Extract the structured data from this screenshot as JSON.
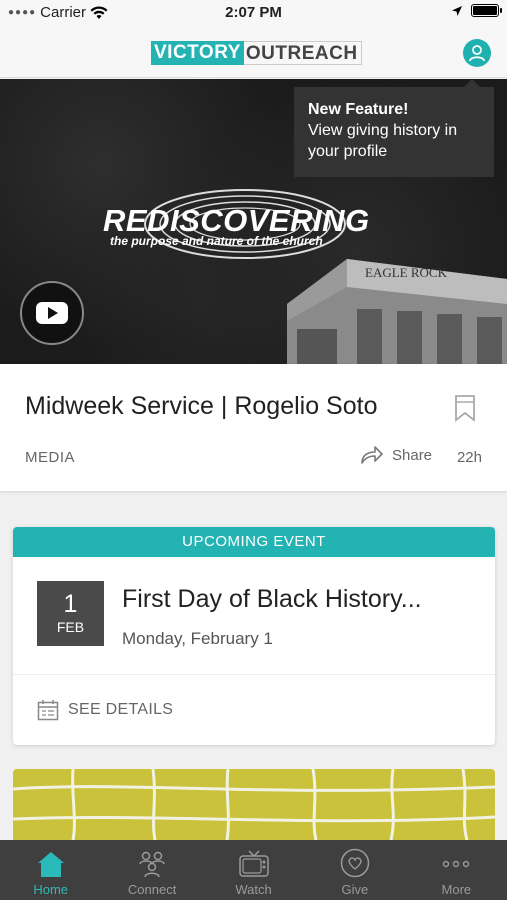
{
  "status": {
    "carrier": "Carrier",
    "time": "2:07 PM"
  },
  "header": {
    "logo_part1": "VICTORY",
    "logo_part2": "OUTREACH"
  },
  "tooltip": {
    "title": "New Feature!",
    "body": "View giving history in your profile"
  },
  "hero": {
    "title": "REDISCOVERING",
    "subtitle": "the purpose and nature of the church",
    "building_sign": "EAGLE ROCK"
  },
  "media": {
    "title": "Midweek Service | Rogelio Soto",
    "tag": "MEDIA",
    "share_label": "Share",
    "time_ago": "22h"
  },
  "event": {
    "header": "UPCOMING EVENT",
    "day": "1",
    "month": "FEB",
    "title": "First Day of Black History...",
    "date": "Monday, February 1",
    "details_label": "SEE DETAILS"
  },
  "tabs": [
    {
      "label": "Home",
      "icon": "home-icon",
      "active": true
    },
    {
      "label": "Connect",
      "icon": "connect-icon",
      "active": false
    },
    {
      "label": "Watch",
      "icon": "tv-icon",
      "active": false
    },
    {
      "label": "Give",
      "icon": "heart-icon",
      "active": false
    },
    {
      "label": "More",
      "icon": "more-icon",
      "active": false
    }
  ],
  "colors": {
    "accent": "#23b3b3",
    "tab_bar": "#3f3f3f",
    "tooltip": "#333333"
  }
}
